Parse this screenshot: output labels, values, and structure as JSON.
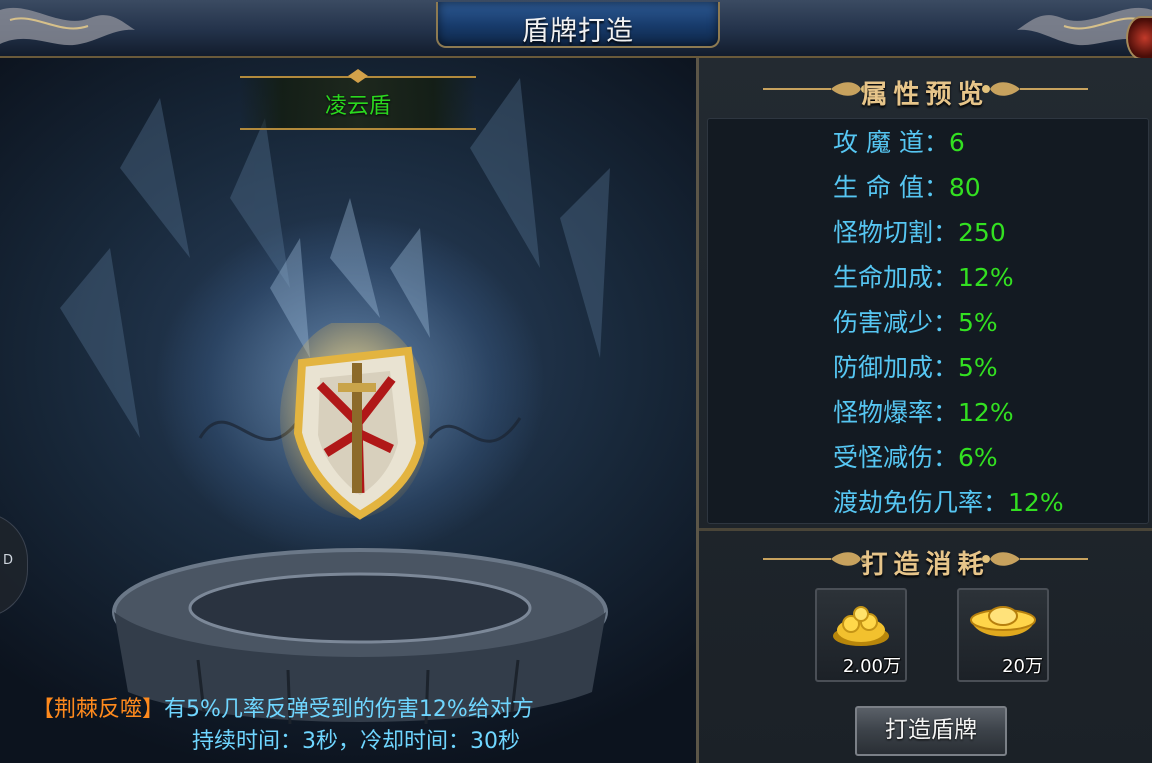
{
  "window": {
    "title": "盾牌打造"
  },
  "showcase": {
    "item_name": "凌云盾",
    "side_tab_label": "D",
    "skill": {
      "name": "【荆棘反噬】",
      "description": "有5%几率反弹受到的伤害12%给对方",
      "duration_cooldown": "持续时间：3秒，冷却时间：30秒"
    }
  },
  "attributes": {
    "title": "属性预览",
    "items": [
      {
        "label": "攻 魔 道：",
        "value": "6"
      },
      {
        "label": "生 命 值：",
        "value": "80"
      },
      {
        "label": "怪物切割：",
        "value": "250"
      },
      {
        "label": "生命加成：",
        "value": "12%"
      },
      {
        "label": "伤害减少：",
        "value": "5%"
      },
      {
        "label": "防御加成：",
        "value": "5%"
      },
      {
        "label": "怪物爆率：",
        "value": "12%"
      },
      {
        "label": "受怪减伤：",
        "value": "6%"
      },
      {
        "label": "渡劫免伤几率：",
        "value": "12%"
      }
    ]
  },
  "cost": {
    "title": "打造消耗",
    "items": [
      {
        "icon": "gold-coins-icon",
        "amount": "2.00万"
      },
      {
        "icon": "gold-ingot-icon",
        "amount": "20万"
      }
    ]
  },
  "forge_button": {
    "label": "打造盾牌"
  },
  "colors": {
    "item_name": "#2bd81f",
    "attr_label": "#56c6f2",
    "attr_value": "#33e021",
    "skill_name": "#ff8a1d",
    "skill_text": "#6fd6ff",
    "section_title": "#e7c58a"
  }
}
